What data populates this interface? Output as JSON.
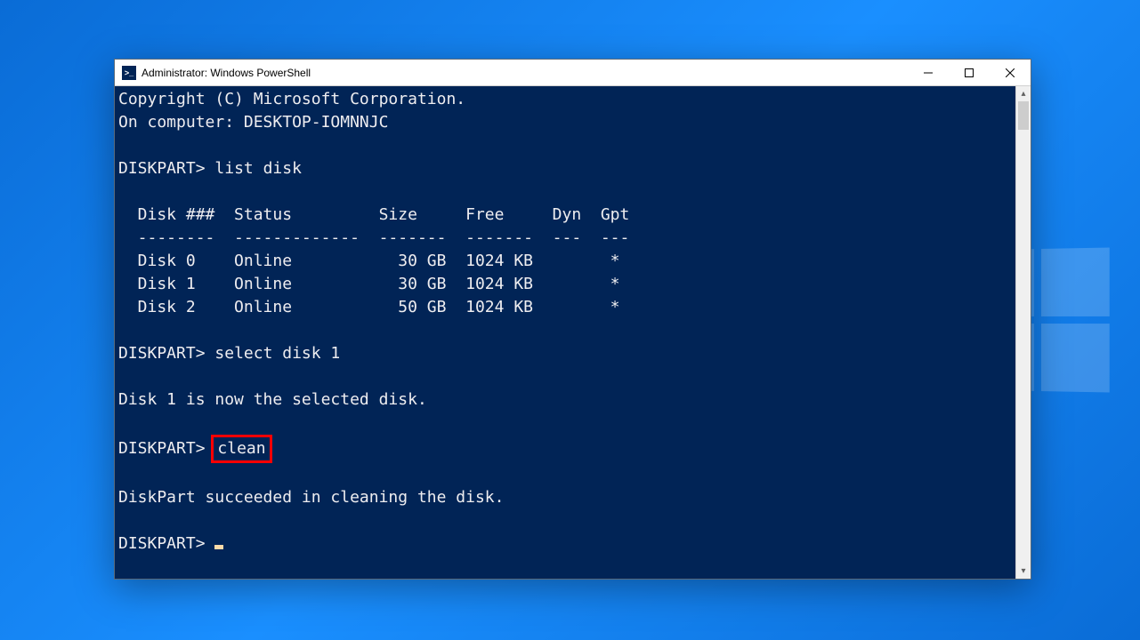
{
  "window": {
    "title": "Administrator: Windows PowerShell",
    "icon_label": ">_"
  },
  "terminal": {
    "copyright": "Copyright (C) Microsoft Corporation.",
    "on_computer": "On computer: DESKTOP-IOMNNJC",
    "prompt": "DISKPART>",
    "cmd_list_disk": "list disk",
    "table_header": "  Disk ###  Status         Size     Free     Dyn  Gpt",
    "table_divider": "  --------  -------------  -------  -------  ---  ---",
    "disks": [
      "  Disk 0    Online           30 GB  1024 KB        *",
      "  Disk 1    Online           30 GB  1024 KB        *",
      "  Disk 2    Online           50 GB  1024 KB        *"
    ],
    "cmd_select_disk": "select disk 1",
    "msg_selected": "Disk 1 is now the selected disk.",
    "cmd_clean": "clean",
    "msg_clean_success": "DiskPart succeeded in cleaning the disk."
  }
}
